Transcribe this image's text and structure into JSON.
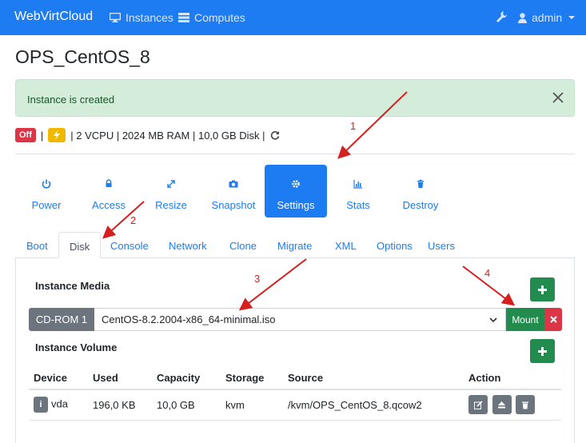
{
  "navbar": {
    "brand": "WebVirtCloud",
    "instances_label": "Instances",
    "computes_label": "Computes",
    "user_label": "admin"
  },
  "page_title": "OPS_CentOS_8",
  "alert": {
    "message": "Instance is created"
  },
  "status": {
    "state_badge": "Off",
    "specs": "| 2 VCPU | 2024 MB RAM | 10,0 GB Disk |"
  },
  "actions": [
    {
      "label": "Power",
      "icon": "power-icon"
    },
    {
      "label": "Access",
      "icon": "lock-icon"
    },
    {
      "label": "Resize",
      "icon": "expand-icon"
    },
    {
      "label": "Snapshot",
      "icon": "camera-icon"
    },
    {
      "label": "Settings",
      "icon": "gear-icon",
      "active": true
    },
    {
      "label": "Stats",
      "icon": "bar-chart-icon"
    },
    {
      "label": "Destroy",
      "icon": "trash-icon"
    }
  ],
  "tabs": [
    "Boot",
    "Disk",
    "Console",
    "Network",
    "Clone",
    "Migrate",
    "XML",
    "Options",
    "Users"
  ],
  "active_tab": "Disk",
  "media": {
    "title": "Instance Media",
    "device_label": "CD-ROM 1",
    "selected_image": "CentOS-8.2.2004-x86_64-minimal.iso",
    "mount_label": "Mount"
  },
  "volume": {
    "title": "Instance Volume",
    "columns": [
      "Device",
      "Used",
      "Capacity",
      "Storage",
      "Source",
      "Action"
    ],
    "rows": [
      {
        "device": "vda",
        "used": "196,0 KB",
        "capacity": "10,0 GB",
        "storage": "kvm",
        "source": "/kvm/OPS_CentOS_8.qcow2"
      }
    ]
  },
  "annotations": [
    "1",
    "2",
    "3",
    "4"
  ],
  "colors": {
    "primary": "#1d7cf2",
    "success": "#218c4e",
    "danger": "#dc3545",
    "secondary": "#6c757d",
    "alert_bg": "#d4edda",
    "annotation": "#d62020"
  }
}
